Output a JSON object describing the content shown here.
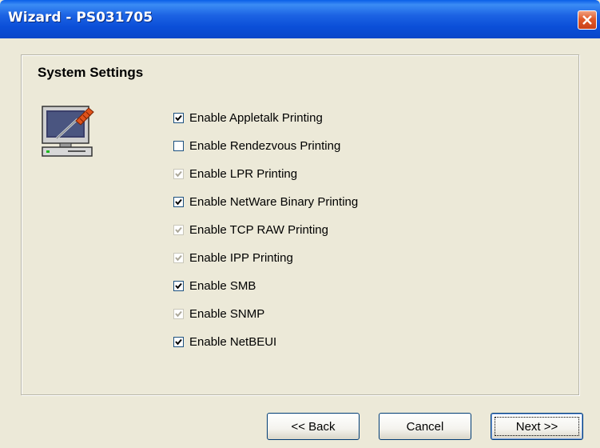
{
  "window": {
    "title": "Wizard - PS031705"
  },
  "panel": {
    "title": "System Settings",
    "icon": "computer-with-screwdriver-icon"
  },
  "options": [
    {
      "label": "Enable Appletalk Printing",
      "checked": true,
      "enabled": true
    },
    {
      "label": "Enable Rendezvous Printing",
      "checked": false,
      "enabled": true
    },
    {
      "label": "Enable LPR Printing",
      "checked": true,
      "enabled": false
    },
    {
      "label": "Enable NetWare Binary Printing",
      "checked": true,
      "enabled": true
    },
    {
      "label": "Enable TCP RAW Printing",
      "checked": true,
      "enabled": false
    },
    {
      "label": "Enable IPP Printing",
      "checked": true,
      "enabled": false
    },
    {
      "label": "Enable SMB",
      "checked": true,
      "enabled": true
    },
    {
      "label": "Enable SNMP",
      "checked": true,
      "enabled": false
    },
    {
      "label": "Enable NetBEUI",
      "checked": true,
      "enabled": true
    }
  ],
  "buttons": {
    "back": "<< Back",
    "cancel": "Cancel",
    "next": "Next >>"
  },
  "colors": {
    "titlebar": "#0b4fd8",
    "close": "#e05a2a",
    "face": "#ece9d8",
    "check_enabled": "#21a121",
    "check_disabled": "#c9c7ba"
  }
}
